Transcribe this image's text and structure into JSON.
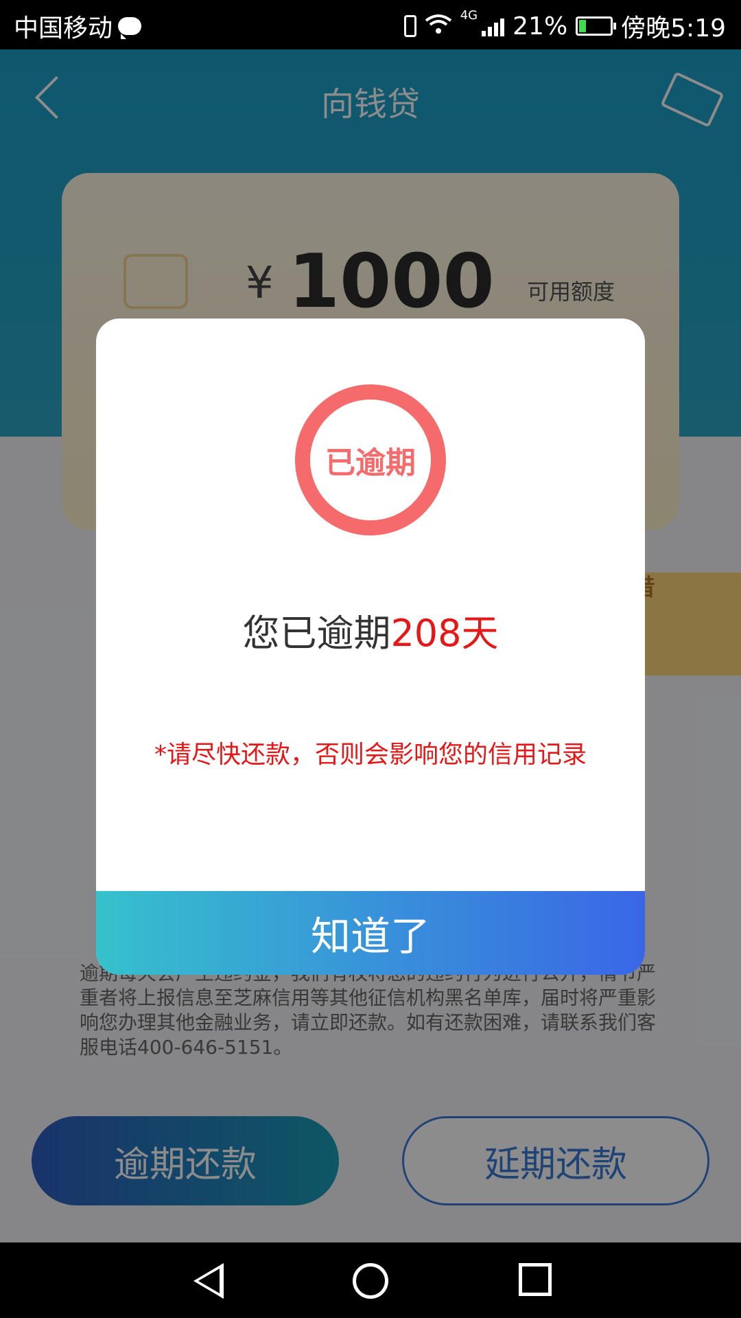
{
  "status_bar": {
    "carrier": "中国移动",
    "network": "4G",
    "battery": "21%",
    "time": "傍晚5:19"
  },
  "header": {
    "title": "向钱贷"
  },
  "card": {
    "currency": "¥",
    "amount": "1000",
    "amount_label": "可用额度"
  },
  "side_badge": {
    "label": "借"
  },
  "notice": {
    "text": "逾期每天会产生违约金，我们有权将您的违约行为进行公开，情节严重者将上报信息至芝麻信用等其他征信机构黑名单库，届时将严重影响您办理其他金融业务，请立即还款。如有还款困难，请联系我们客服电话400-646-5151。"
  },
  "buttons": {
    "overdue_repay": "逾期还款",
    "extend_repay": "延期还款"
  },
  "dialog": {
    "badge": "已逾期",
    "message_prefix": "您已逾期",
    "days": "208天",
    "warning": "*请尽快还款，否则会影响您的信用记录",
    "confirm": "知道了"
  },
  "colors": {
    "header": "#1c9fc6",
    "alert_red": "#e51818",
    "ring": "#f56b6b",
    "button_gradient_start": "#36c1cc",
    "button_gradient_end": "#3a66e6"
  }
}
